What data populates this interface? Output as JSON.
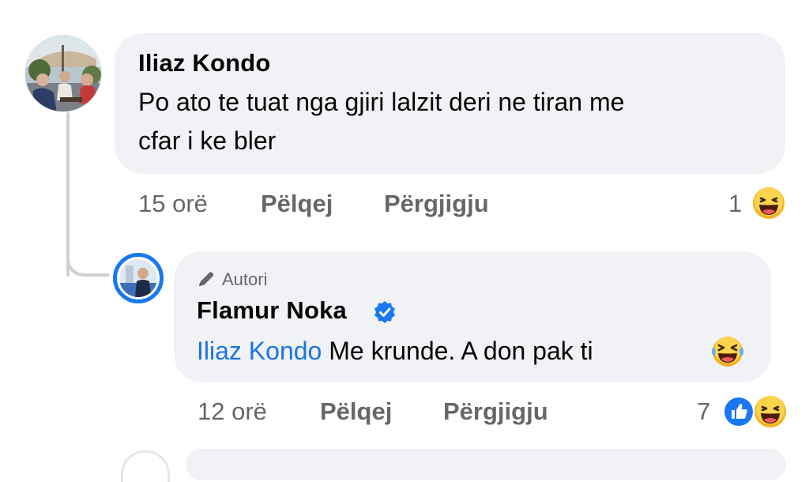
{
  "comment": {
    "author": "Iliaz Kondo",
    "text_line1": "Po ato te tuat nga gjiri lalzit deri ne tiran me",
    "text_line2": "cfar i ke bler",
    "time": "15 orë",
    "like_label": "Pëlqej",
    "reply_label": "Përgjigju",
    "reaction_count": "1",
    "reactions": [
      "haha-emoji"
    ]
  },
  "reply": {
    "tag": "Autori",
    "author": "Flamur Noka",
    "verified": true,
    "mention": "Iliaz Kondo",
    "text": "Me krunde.  A don pak ti",
    "time": "12 orë",
    "like_label": "Pëlqej",
    "reply_label": "Përgjigju",
    "reaction_count": "7",
    "reactions": [
      "like-emoji",
      "haha-emoji"
    ]
  },
  "colors": {
    "bubble": "#f0f2f5",
    "secondary_text": "#65676b",
    "mention": "#1b74e4",
    "verified": "#1877f2",
    "thread_line": "#ced0d4"
  }
}
